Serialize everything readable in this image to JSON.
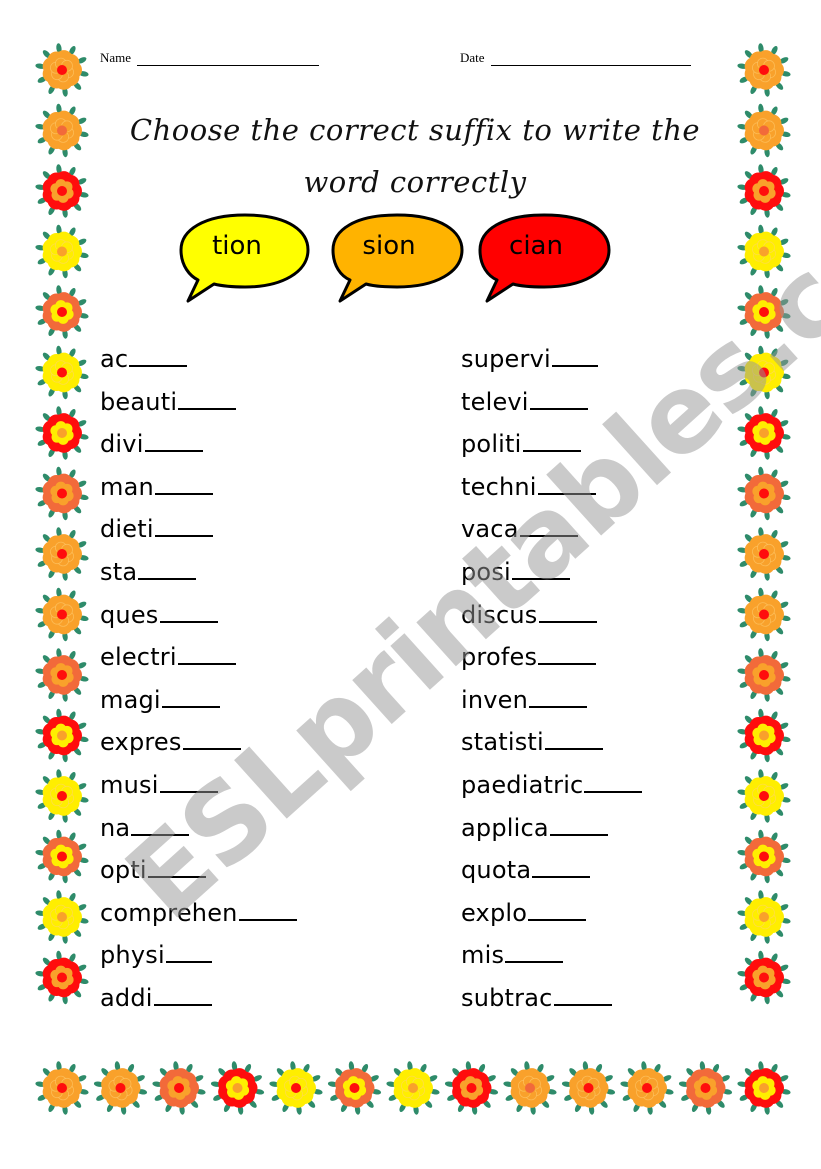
{
  "header": {
    "name_label": "Name",
    "date_label": "Date"
  },
  "title": {
    "line1": "Choose the correct suffix to write the",
    "line2": "word correctly"
  },
  "suffixes": [
    {
      "label": "tion",
      "color": "#ffff00"
    },
    {
      "label": "sion",
      "color": "#ffb300"
    },
    {
      "label": "cian",
      "color": "#ff0000"
    }
  ],
  "words_left": [
    {
      "stem": "ac"
    },
    {
      "stem": "beauti"
    },
    {
      "stem": "divi"
    },
    {
      "stem": "man"
    },
    {
      "stem": "dieti"
    },
    {
      "stem": "sta"
    },
    {
      "stem": "ques"
    },
    {
      "stem": "electri"
    },
    {
      "stem": "magi"
    },
    {
      "stem": "expres"
    },
    {
      "stem": "musi"
    },
    {
      "stem": "na"
    },
    {
      "stem": "opti"
    },
    {
      "stem": "comprehen"
    },
    {
      "stem": "physi"
    },
    {
      "stem": "addi"
    }
  ],
  "words_right": [
    {
      "stem": "supervi"
    },
    {
      "stem": "televi"
    },
    {
      "stem": "politi"
    },
    {
      "stem": "techni"
    },
    {
      "stem": "vaca"
    },
    {
      "stem": "posi"
    },
    {
      "stem": "discus"
    },
    {
      "stem": "profes"
    },
    {
      "stem": "inven"
    },
    {
      "stem": "statisti"
    },
    {
      "stem": "paediatric"
    },
    {
      "stem": "applica"
    },
    {
      "stem": "quota"
    },
    {
      "stem": "explo"
    },
    {
      "stem": "mis"
    },
    {
      "stem": "subtrac"
    }
  ],
  "watermark": "ESLprintables.com",
  "border": {
    "icon": "flower-icon",
    "palette": {
      "orange": "#f9a12b",
      "coral": "#f26a3a",
      "red": "#ff0d0d",
      "yellow": "#ffee00",
      "leaf": "#2e8b6a"
    },
    "column_sequence": [
      "A",
      "B",
      "C",
      "D",
      "E",
      "F",
      "G",
      "H",
      "A",
      "A",
      "H",
      "G",
      "F",
      "E",
      "D",
      "C"
    ],
    "bottom_sequence": [
      "A",
      "A",
      "H",
      "G",
      "F",
      "E",
      "D",
      "C",
      "B",
      "A",
      "A",
      "H",
      "G"
    ]
  }
}
